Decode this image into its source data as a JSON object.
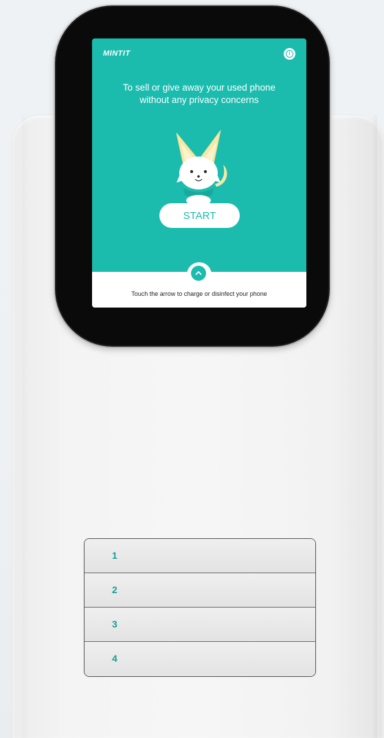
{
  "screen": {
    "logo": "MINTIT",
    "info_icon": "info-icon",
    "headline_line1": "To sell or give away your used phone",
    "headline_line2": "without any privacy concerns",
    "start_label": "START",
    "bottom_hint": "Touch the arrow to charge or disinfect your phone",
    "arrow_icon": "chevron-up-icon"
  },
  "locker": {
    "slots": [
      "1",
      "2",
      "3",
      "4"
    ]
  },
  "colors": {
    "accent": "#1bbcae",
    "slot_number": "#159f96",
    "bezel": "#0a0a0a",
    "panel": "#f4f4f4"
  }
}
